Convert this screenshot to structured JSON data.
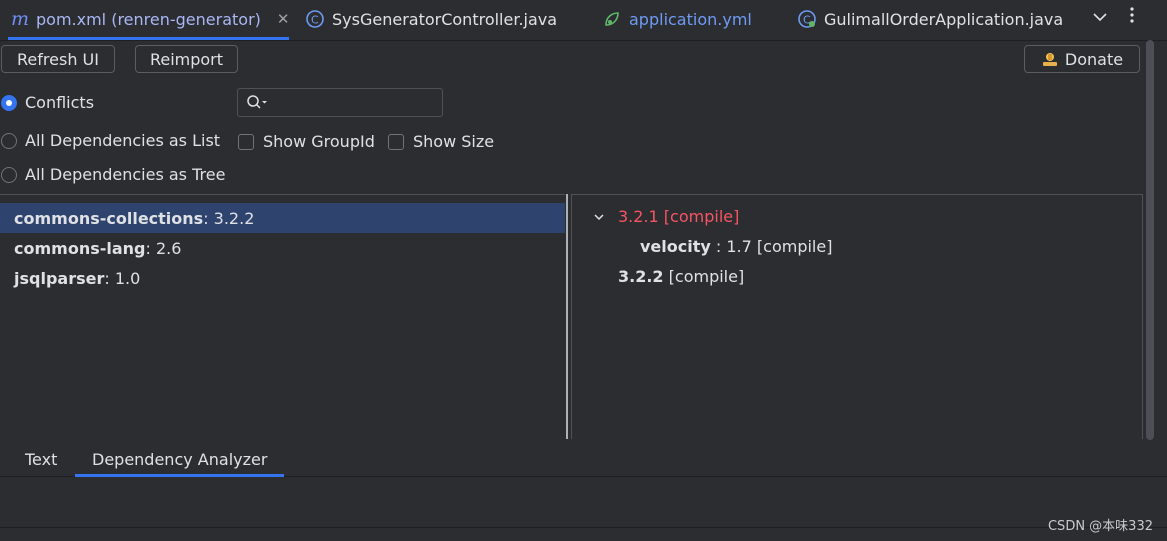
{
  "tabs": [
    {
      "label": "pom.xml (renren-generator)",
      "icon": "maven-icon",
      "active": true,
      "closable": true
    },
    {
      "label": "SysGeneratorController.java",
      "icon": "class-icon"
    },
    {
      "label": "application.yml",
      "icon": "yaml-icon"
    },
    {
      "label": "GulimallOrderApplication.java",
      "icon": "spring-class-icon"
    }
  ],
  "toolbar": {
    "refresh_label": "Refresh UI",
    "reimport_label": "Reimport",
    "donate_label": "Donate"
  },
  "view_mode": {
    "options": [
      "Conflicts",
      "All Dependencies as List",
      "All Dependencies as Tree"
    ],
    "selected": "Conflicts"
  },
  "search": {
    "placeholder": "",
    "value": ""
  },
  "checkboxes": {
    "show_groupid": {
      "label": "Show GroupId",
      "checked": false
    },
    "show_size": {
      "label": "Show Size",
      "checked": false
    }
  },
  "dependencies": [
    {
      "name": "commons-collections",
      "version": " : 3.2.2",
      "selected": true
    },
    {
      "name": "commons-lang",
      "version": " : 2.6"
    },
    {
      "name": "jsqlparser",
      "version": " : 1.0"
    }
  ],
  "tree": {
    "conflict_version": "3.2.1 [compile]",
    "child_name": "velocity",
    "child_version": " : 1.7 [compile]",
    "resolved_version": "3.2.2",
    "resolved_scope": " [compile]"
  },
  "bottom_tabs": [
    {
      "label": "Text"
    },
    {
      "label": "Dependency Analyzer",
      "active": true
    }
  ],
  "watermark": "CSDN @本味332",
  "colors": {
    "accent": "#3574f0",
    "conflict": "#f75464",
    "selection": "#2e436e"
  }
}
